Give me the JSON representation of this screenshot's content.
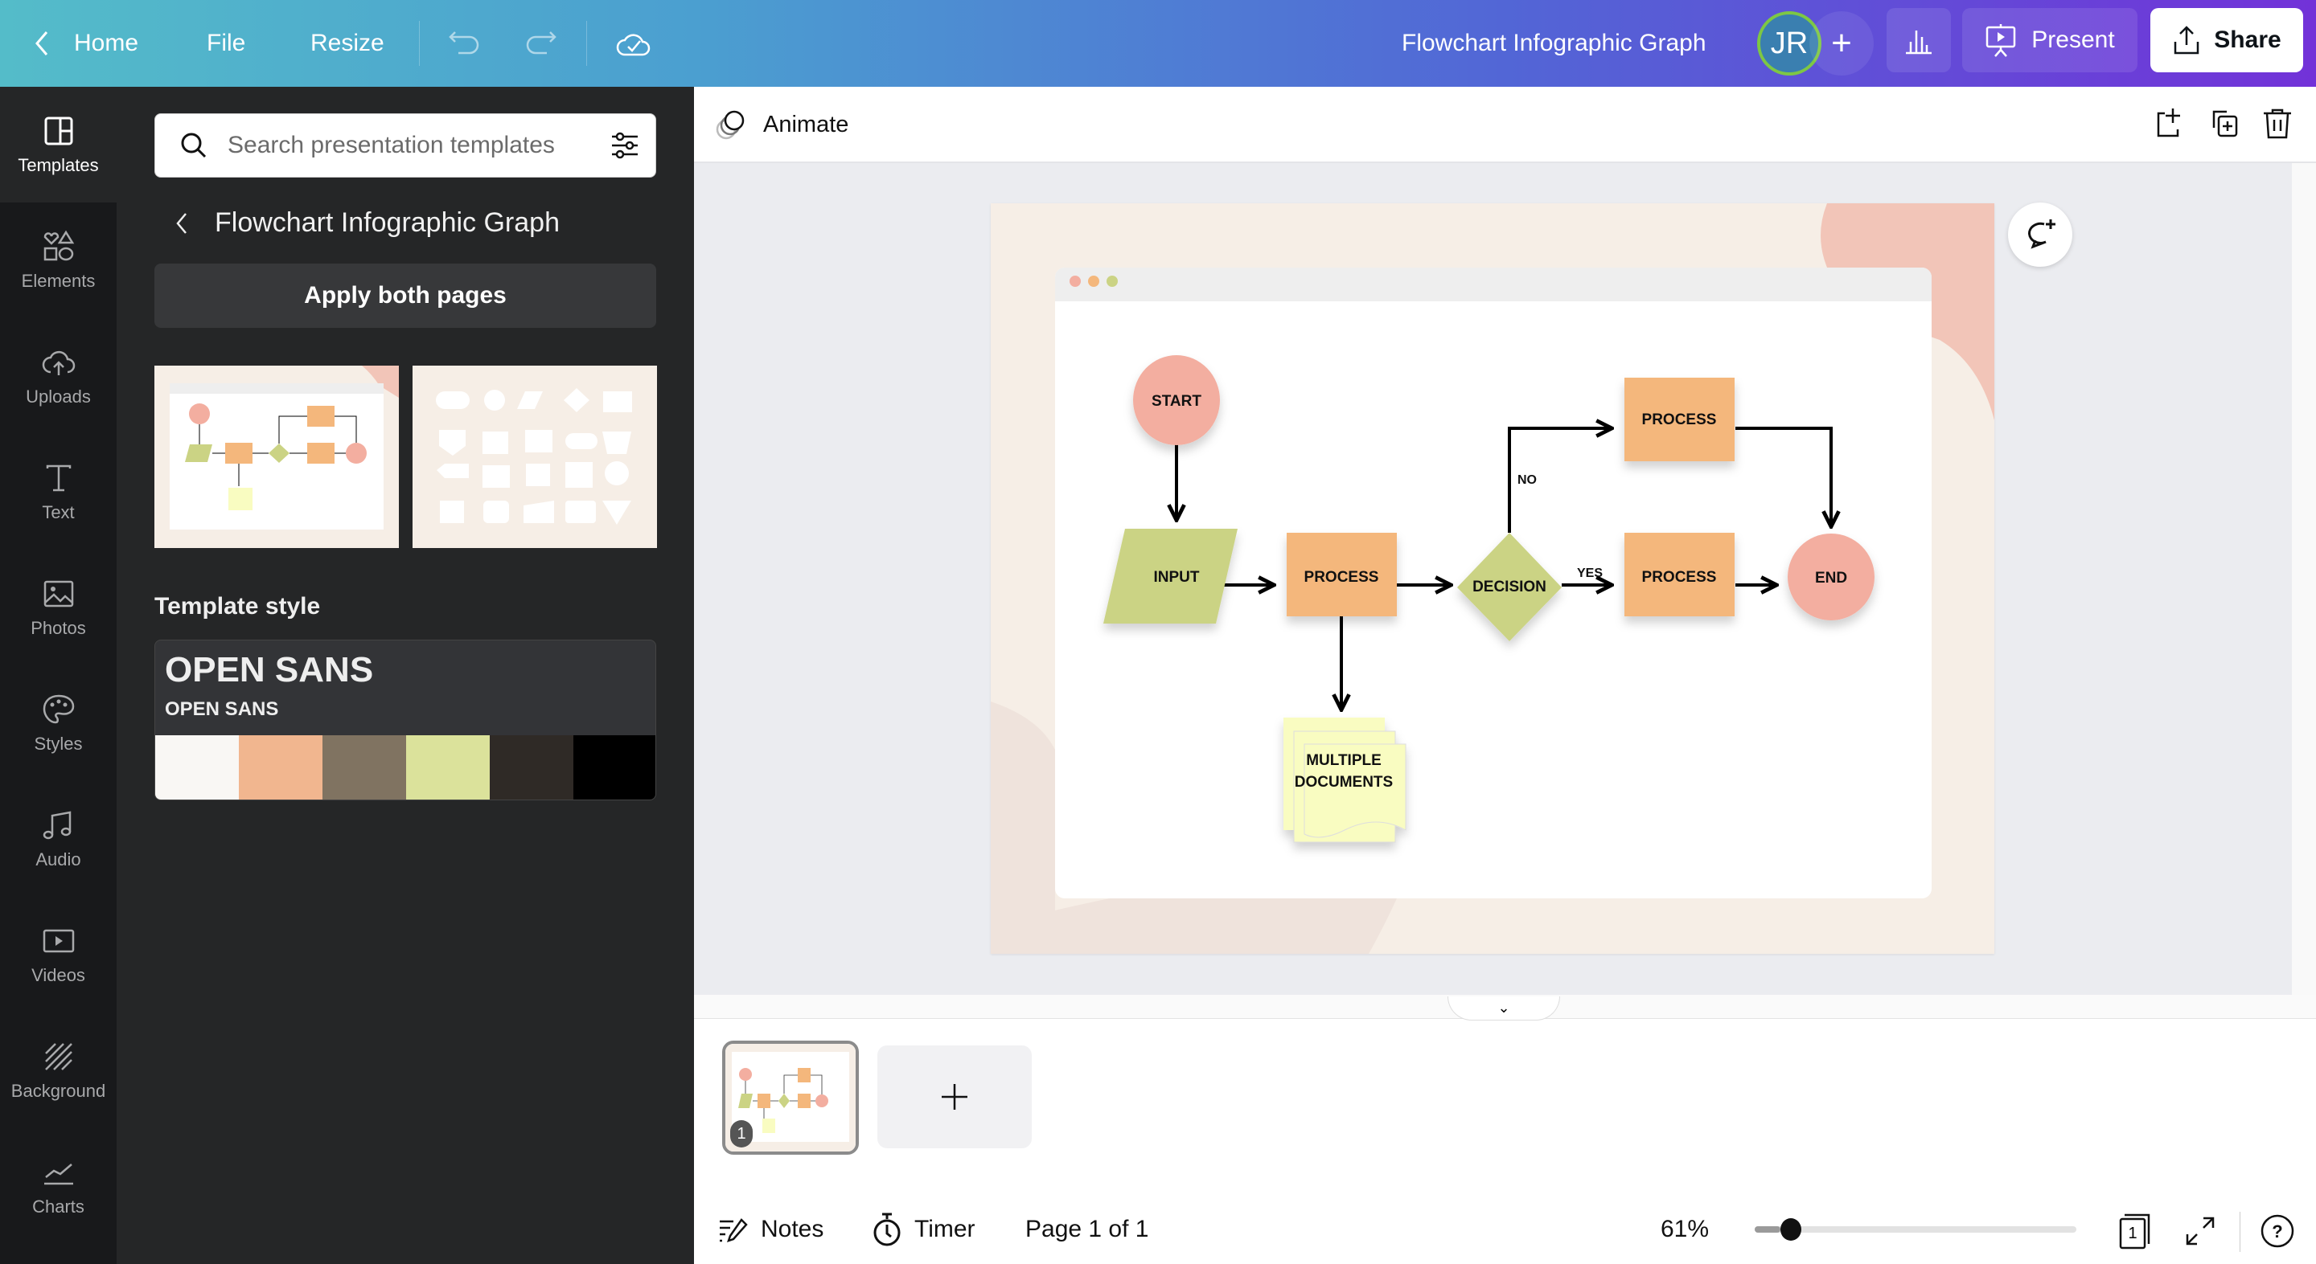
{
  "topbar": {
    "home_label": "Home",
    "file_label": "File",
    "resize_label": "Resize",
    "doc_title": "Flowchart Infographic Graph",
    "avatar_initials": "JR",
    "present_label": "Present",
    "share_label": "Share"
  },
  "rail": {
    "items": [
      {
        "label": "Templates",
        "icon": "templates-icon",
        "active": true
      },
      {
        "label": "Elements",
        "icon": "elements-icon"
      },
      {
        "label": "Uploads",
        "icon": "upload-cloud-icon"
      },
      {
        "label": "Text",
        "icon": "text-icon"
      },
      {
        "label": "Photos",
        "icon": "photo-icon"
      },
      {
        "label": "Styles",
        "icon": "palette-icon"
      },
      {
        "label": "Audio",
        "icon": "music-note-icon"
      },
      {
        "label": "Videos",
        "icon": "video-icon"
      },
      {
        "label": "Background",
        "icon": "background-hatch-icon"
      },
      {
        "label": "Charts",
        "icon": "chart-line-icon"
      }
    ]
  },
  "panel": {
    "search_placeholder": "Search presentation templates",
    "collection_title": "Flowchart Infographic Graph",
    "apply_label": "Apply both pages",
    "template_style_label": "Template style",
    "font_heading": "OPEN SANS",
    "font_body": "OPEN SANS",
    "swatches": [
      "#f9f7f4",
      "#f1b68f",
      "#807361",
      "#dbe29b",
      "#2f2a26",
      "#000000"
    ]
  },
  "toolbar": {
    "animate_label": "Animate"
  },
  "flowchart": {
    "start": "START",
    "input": "INPUT",
    "process_main": "PROCESS",
    "decision": "DECISION",
    "process_no": "PROCESS",
    "process_yes": "PROCESS",
    "end": "END",
    "docs_line1": "MULTIPLE",
    "docs_line2": "DOCUMENTS",
    "label_no": "NO",
    "label_yes": "YES",
    "colors": {
      "terminal": "#f3aea0",
      "process": "#f4b77c",
      "decision": "#cbd384",
      "docs": "#f9fcc1",
      "page_bg": "#f6eee6",
      "blob": "#f2c5b8"
    }
  },
  "pages_strip": {
    "page_number_badge": "1"
  },
  "footer": {
    "notes_label": "Notes",
    "timer_label": "Timer",
    "page_indicator": "Page 1 of 1",
    "zoom_percent": "61%",
    "zoom_slider_fraction": 0.08,
    "page_count_badge": "1"
  }
}
